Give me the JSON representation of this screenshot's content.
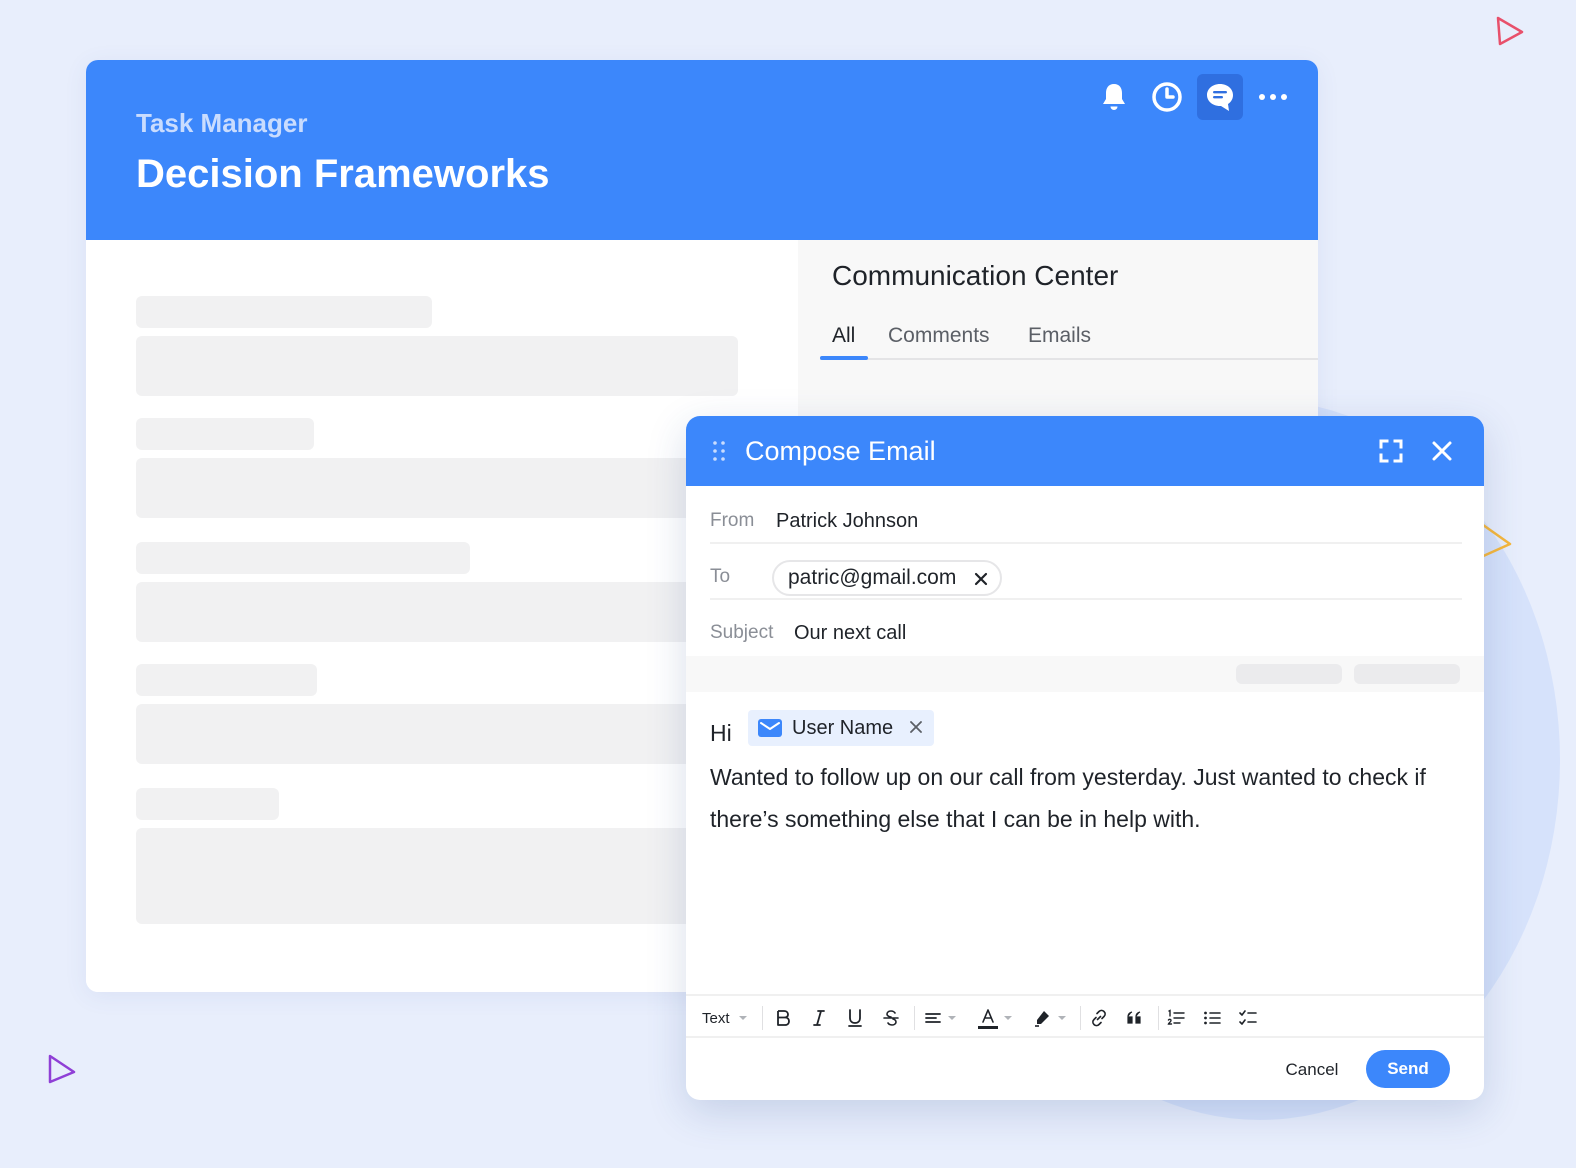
{
  "header": {
    "app_name": "Task Manager",
    "page_title": "Decision Frameworks"
  },
  "communication_center": {
    "title": "Communication Center",
    "tabs": [
      {
        "label": "All",
        "active": true
      },
      {
        "label": "Comments",
        "active": false
      },
      {
        "label": "Emails",
        "active": false
      }
    ]
  },
  "compose": {
    "title": "Compose Email",
    "from_label": "From",
    "from_value": "Patrick Johnson",
    "to_label": "To",
    "to_recipient": "patric@gmail.com",
    "subject_label": "Subject",
    "subject_value": "Our next call",
    "greeting": "Hi",
    "mention": "User Name",
    "body": "Wanted to follow up on our call from yesterday. Just wanted to check if there’s something else that I can be in help with.",
    "toolbar": {
      "text_style": "Text",
      "text_color_icon": "text-color-icon"
    },
    "cancel_label": "Cancel",
    "send_label": "Send"
  },
  "colors": {
    "accent": "#3c87fb",
    "background": "#e8eefc",
    "deco_red": "#e8506b",
    "deco_yellow": "#f6b73c",
    "deco_purple": "#8f3fd6"
  }
}
